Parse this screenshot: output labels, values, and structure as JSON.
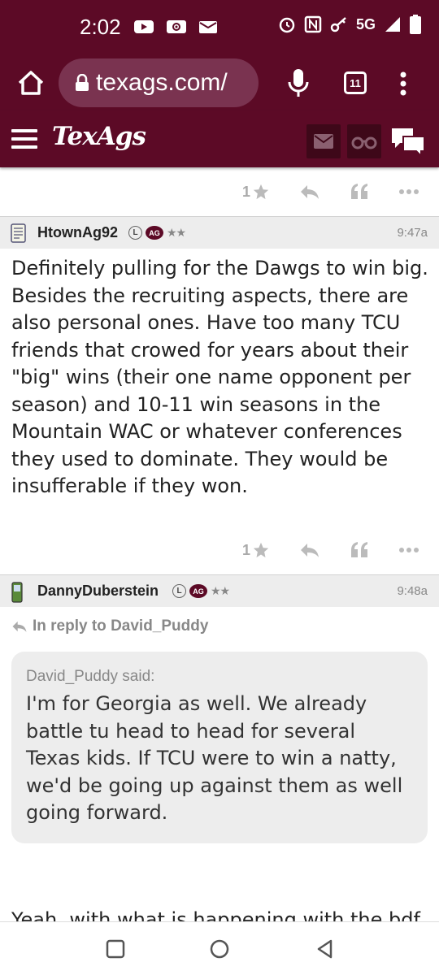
{
  "status_bar": {
    "time": "2:02",
    "network": "5G",
    "left_icons": [
      "youtube-icon",
      "radio-icon",
      "mail-icon"
    ],
    "right_icons": [
      "alarm-icon",
      "nfc-icon",
      "key-icon",
      "signal-icon",
      "battery-icon"
    ]
  },
  "browser": {
    "url": "texags.com/",
    "tab_count": "11"
  },
  "site_header": {
    "logo": "TexAgs"
  },
  "posts": [
    {
      "rating": "1",
      "actions": [
        "star-icon",
        "reply-icon",
        "quote-icon",
        "more-icon"
      ]
    },
    {
      "username": "HtownAg92",
      "badge_l": "L",
      "badge_ag": "AG",
      "stars": "★★",
      "time": "9:47a",
      "body": "Definitely pulling for the Dawgs to win big. Besides the recruiting aspects, there are also personal ones. Have too many TCU friends that crowed for years about their \"big\" wins (their one name opponent per season) and 10-11 win seasons in the Mountain WAC or whatever conferences they used to dominate. They would be insufferable if they won.",
      "rating": "1"
    },
    {
      "username": "DannyDuberstein",
      "badge_l": "L",
      "badge_ag": "AG",
      "stars": "★★",
      "time": "9:48a",
      "reply_to": "In reply to David_Puddy",
      "quote_author": "David_Puddy said:",
      "quote_text": "I'm for Georgia as well. We already battle tu head to head for several Texas kids. If TCU were to win a natty, we'd be going up against them as well going forward.",
      "body_start": "Yeah, with what is happening with the bdf"
    }
  ],
  "nav_bar": {
    "buttons": [
      "recents-icon",
      "home-icon",
      "back-icon"
    ]
  },
  "colors": {
    "maroon": "#5c0a26",
    "gray_header": "#ededed"
  }
}
